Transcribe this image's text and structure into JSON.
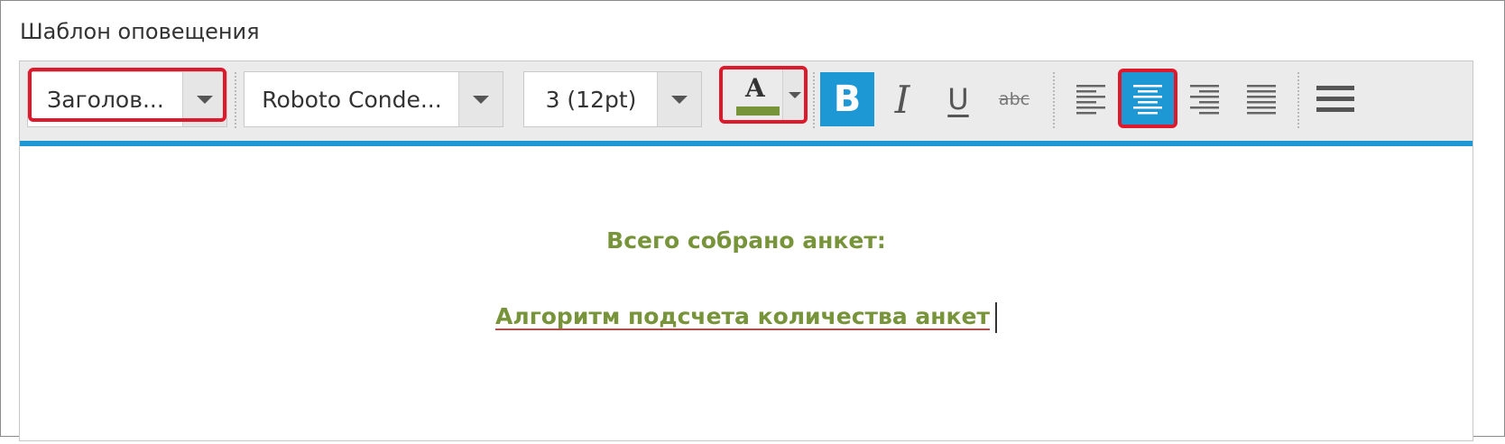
{
  "panel": {
    "title": "Шаблон оповещения"
  },
  "toolbar": {
    "format_select": "Заголов...",
    "font_select": "Roboto Conde...",
    "size_select": "3 (12pt)",
    "font_color": {
      "letter": "A",
      "color": "#78943a"
    },
    "buttons": {
      "bold": "B",
      "italic": "I",
      "underline": "U",
      "strikethrough": "abc"
    },
    "align": {
      "active": "center"
    },
    "accent_color": "#1e97d5",
    "highlight_color": "#e0182c"
  },
  "content": {
    "line1": "Всего собрано анкет:",
    "line2": "Алгоритм подсчета количества анкет",
    "text_color": "#78943a"
  }
}
